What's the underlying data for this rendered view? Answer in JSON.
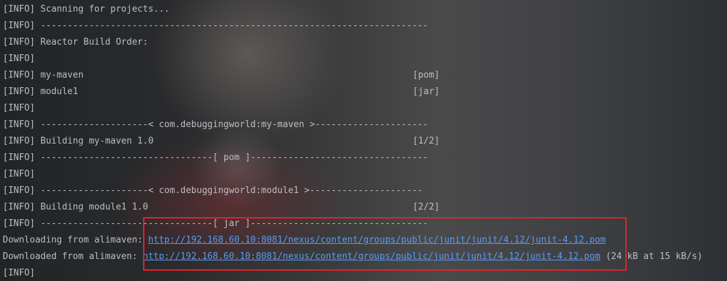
{
  "console": {
    "lines": [
      {
        "text": "[INFO] Scanning for projects...",
        "tag": ""
      },
      {
        "text": "[INFO] ------------------------------------------------------------------------",
        "tag": ""
      },
      {
        "text": "[INFO] Reactor Build Order:",
        "tag": ""
      },
      {
        "text": "[INFO]",
        "tag": ""
      },
      {
        "text": "[INFO] my-maven",
        "tag": "[pom]"
      },
      {
        "text": "[INFO] module1",
        "tag": "[jar]"
      },
      {
        "text": "[INFO]",
        "tag": ""
      },
      {
        "text": "[INFO] --------------------< com.debuggingworld:my-maven >---------------------",
        "tag": ""
      },
      {
        "text": "[INFO] Building my-maven 1.0",
        "tag": "[1/2]"
      },
      {
        "text": "[INFO] --------------------------------[ pom ]---------------------------------",
        "tag": ""
      },
      {
        "text": "[INFO]",
        "tag": ""
      },
      {
        "text": "[INFO] --------------------< com.debuggingworld:module1 >---------------------",
        "tag": ""
      },
      {
        "text": "[INFO] Building module1 1.0",
        "tag": "[2/2]"
      },
      {
        "text": "[INFO] --------------------------------[ jar ]---------------------------------",
        "tag": ""
      }
    ],
    "downloading": {
      "prefix": "Downloading from alimaven: ",
      "url": "http://192.168.60.10:8081/nexus/content/groups/public/junit/junit/4.12/junit-4.12.pom"
    },
    "downloaded": {
      "prefix": "Downloaded from alimaven: ",
      "url": "http://192.168.60.10:8081/nexus/content/groups/public/junit/junit/4.12/junit-4.12.pom",
      "suffix": " (24 kB at 15 kB/s)"
    },
    "last_line": "[INFO]"
  },
  "colors": {
    "text": "#bcbec4",
    "link": "#589df6",
    "highlight_border": "#e8212b"
  }
}
